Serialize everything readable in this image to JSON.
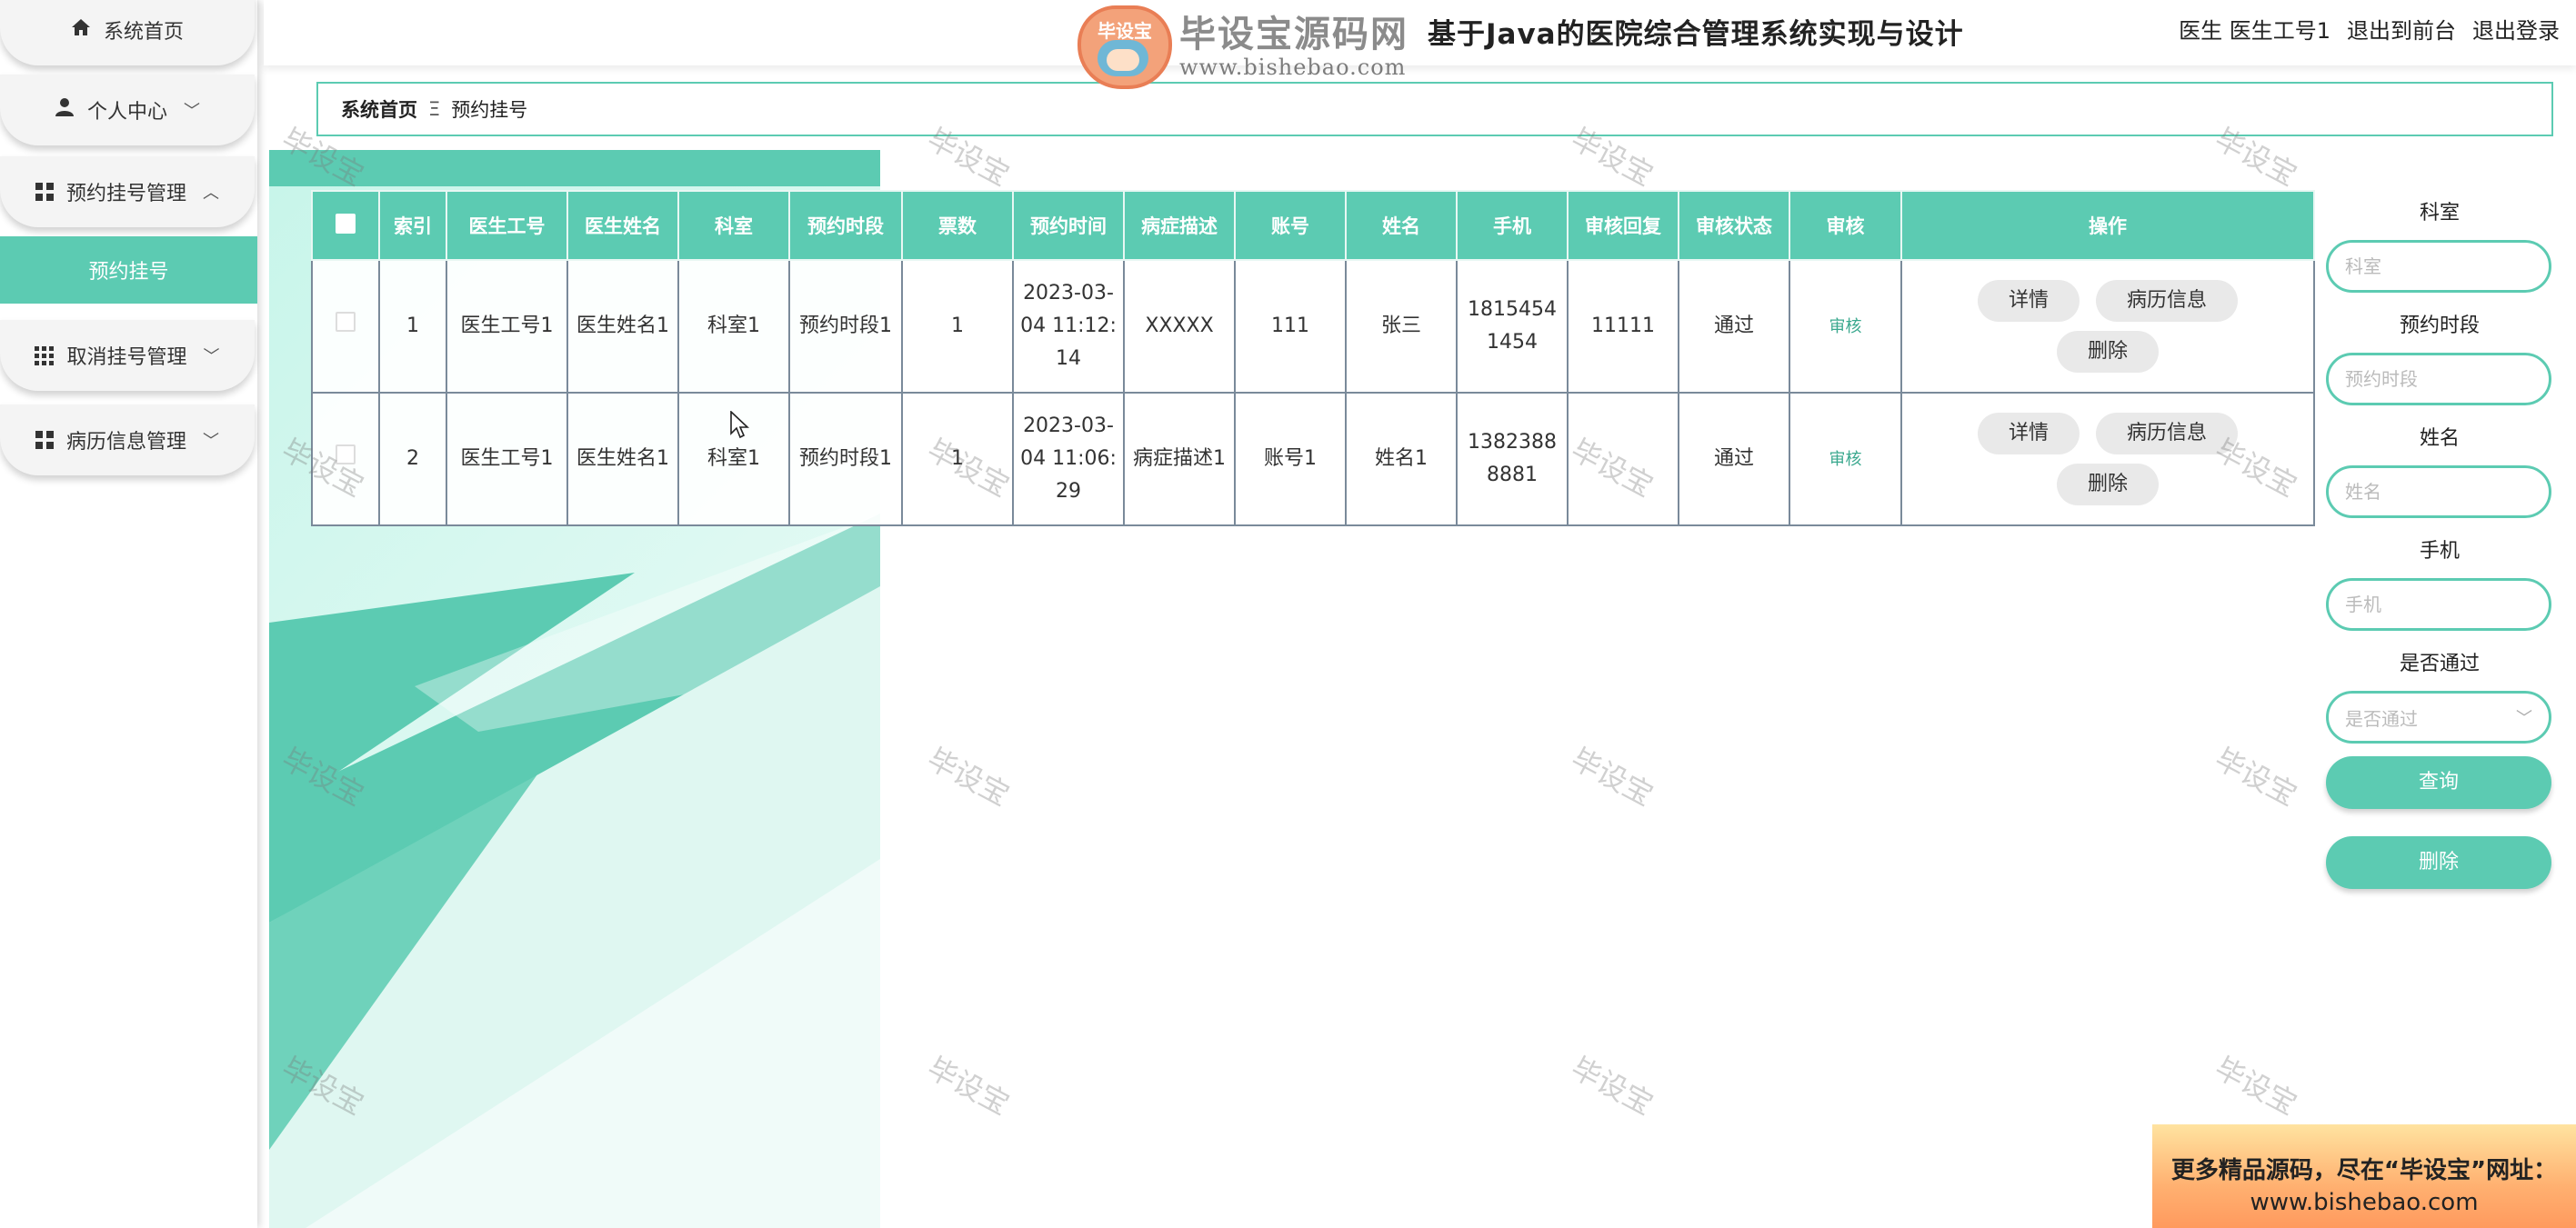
{
  "header": {
    "title": "基于Java的医院综合管理系统实现与设计",
    "user_label": "医生 医生工号1",
    "back_front": "退出到前台",
    "logout": "退出登录"
  },
  "logo": {
    "badge_text": "毕设宝",
    "name": "毕设宝源码网",
    "url": "www.bishebao.com"
  },
  "sidebar": {
    "items": [
      {
        "label": "系统首页"
      },
      {
        "label": "个人中心"
      },
      {
        "label": "预约挂号管理"
      },
      {
        "label": "取消挂号管理"
      },
      {
        "label": "病历信息管理"
      }
    ],
    "active_sub": "预约挂号"
  },
  "breadcrumb": {
    "home": "系统首页",
    "separator": "Ξ",
    "current": "预约挂号"
  },
  "table": {
    "headers": [
      "",
      "索引",
      "医生工号",
      "医生姓名",
      "科室",
      "预约时段",
      "票数",
      "预约时间",
      "病症描述",
      "账号",
      "姓名",
      "手机",
      "审核回复",
      "审核状态",
      "审核",
      "操作"
    ],
    "rows": [
      {
        "index": "1",
        "doctor_no": "医生工号1",
        "doctor_name": "医生姓名1",
        "department": "科室1",
        "time_slot": "预约时段1",
        "tickets": "1",
        "appt_time": "2023-03-04 11:12:14",
        "symptom": "XXXXX",
        "account": "111",
        "name": "张三",
        "phone": "18154541454",
        "audit_reply": "11111",
        "audit_status": "通过",
        "audit_link": "审核"
      },
      {
        "index": "2",
        "doctor_no": "医生工号1",
        "doctor_name": "医生姓名1",
        "department": "科室1",
        "time_slot": "预约时段1",
        "tickets": "1",
        "appt_time": "2023-03-04 11:06:29",
        "symptom": "病症描述1",
        "account": "账号1",
        "name": "姓名1",
        "phone": "13823888881",
        "audit_reply": "",
        "audit_status": "通过",
        "audit_link": "审核"
      }
    ],
    "actions": {
      "detail": "详情",
      "record": "病历信息",
      "delete": "删除"
    }
  },
  "search": {
    "department_label": "科室",
    "department_placeholder": "科室",
    "slot_label": "预约时段",
    "slot_placeholder": "预约时段",
    "name_label": "姓名",
    "name_placeholder": "姓名",
    "phone_label": "手机",
    "phone_placeholder": "手机",
    "pass_label": "是否通过",
    "pass_placeholder": "是否通过",
    "query_btn": "查询",
    "delete_btn": "删除"
  },
  "watermark": "毕设宝",
  "banner": {
    "line1": "更多精品源码，尽在“毕设宝”网址：",
    "line2": "www.bishebao.com"
  },
  "colors": {
    "accent": "#5ccbb2",
    "banner_top": "#ffe3a0",
    "banner_bottom": "#ff9a5e"
  }
}
